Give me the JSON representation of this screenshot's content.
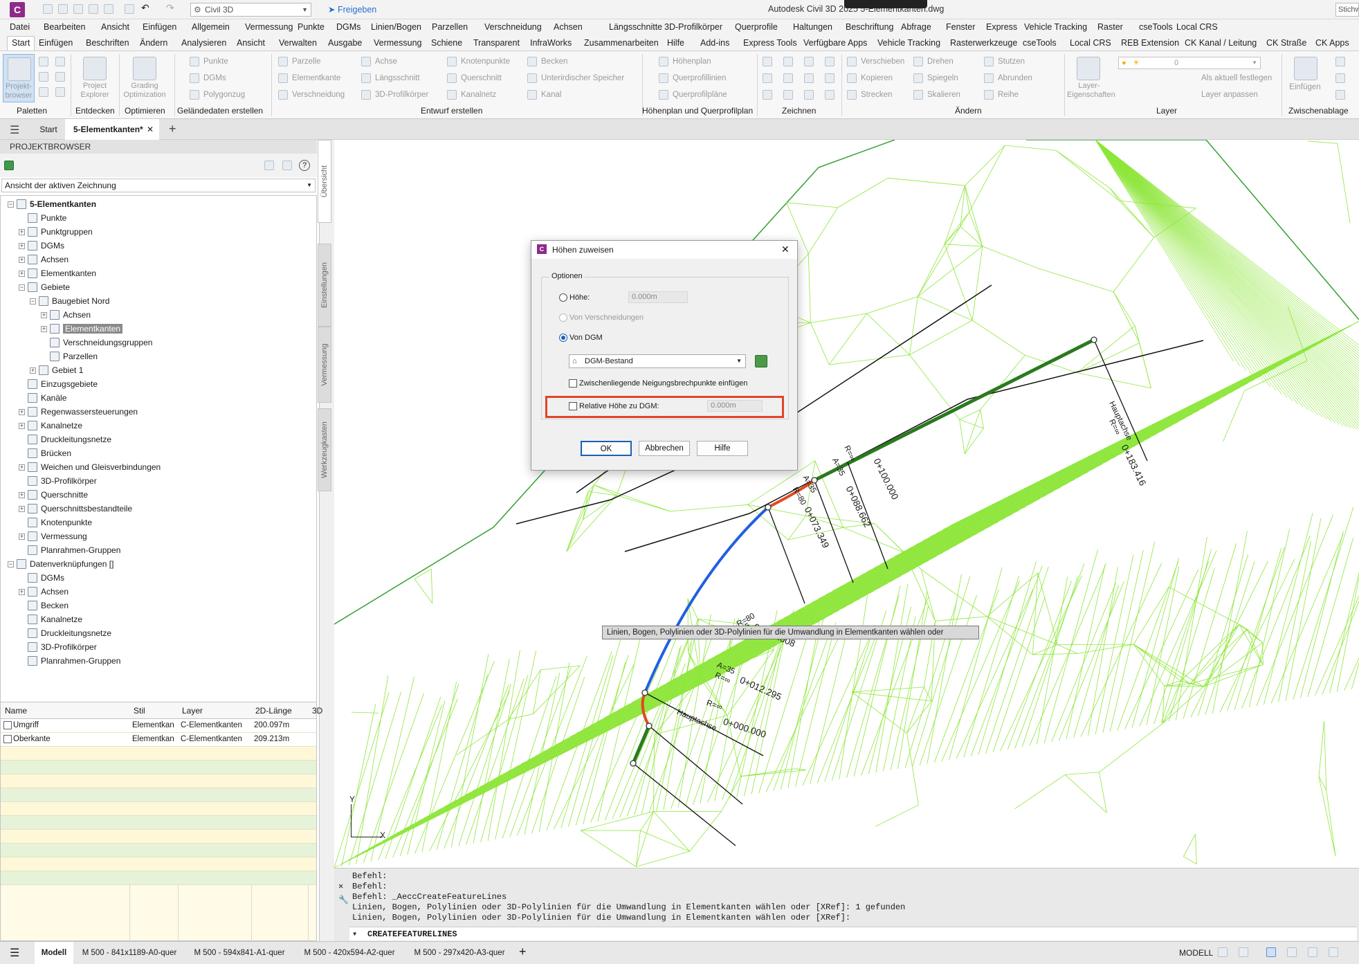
{
  "title": {
    "app_logo": "C",
    "workspace": "Civil 3D",
    "share": "Freigeben",
    "window_title": "Autodesk Civil 3D 2025   5-Elementkanten.dwg",
    "search": "Stichw"
  },
  "menu": [
    "Datei",
    "Bearbeiten",
    "Ansicht",
    "Einfügen",
    "Allgemein",
    "Vermessung",
    "Punkte",
    "DGMs",
    "Linien/Bogen",
    "Parzellen",
    "Verschneidung",
    "Achsen",
    "Längsschnitte",
    "3D-Profilkörper",
    "Querprofile",
    "Haltungen",
    "Beschriftung",
    "Abfrage",
    "Fenster",
    "Express",
    "Vehicle Tracking",
    "Raster",
    "cseTools",
    "Local CRS"
  ],
  "tabs": [
    "Start",
    "Einfügen",
    "Beschriften",
    "Ändern",
    "Analysieren",
    "Ansicht",
    "Verwalten",
    "Ausgabe",
    "Vermessung",
    "Schiene",
    "Transparent",
    "InfraWorks",
    "Zusammenarbeiten",
    "Hilfe",
    "Add-ins",
    "Express Tools",
    "Verfügbare Apps",
    "Vehicle Tracking",
    "Rasterwerkzeuge",
    "cseTools",
    "Local CRS",
    "REB Extension",
    "CK Kanal / Leitung",
    "CK Straße",
    "CK Apps"
  ],
  "ribbon": {
    "projektbrowser": "Projekt-browser",
    "projektexplorer": "Project Explorer",
    "grading": "Grading Optimization",
    "punkte": "Punkte",
    "dgms": "DGMs",
    "polygonzug": "Polygonzug",
    "parzelle": "Parzelle",
    "elementkante": "Elementkante",
    "verschneidung": "Verschneidung",
    "achse": "Achse",
    "laengsschnitt": "Längsschnitt",
    "profilkoerper": "3D-Profilkörper",
    "knotenpunkte": "Knotenpunkte",
    "querschnitt": "Querschnitt",
    "kanalnetz": "Kanalnetz",
    "becken": "Becken",
    "speicher": "Unterirdischer Speicher",
    "kanal": "Kanal",
    "hoehenplan": "Höhenplan",
    "querprofillinien": "Querprofillinien",
    "querprofilplaene": "Querprofilpläne",
    "verschieben": "Verschieben",
    "drehen": "Drehen",
    "stutzen": "Stutzen",
    "kopieren": "Kopieren",
    "spiegeln": "Spiegeln",
    "abrunden": "Abrunden",
    "strecken": "Strecken",
    "skalieren": "Skalieren",
    "reihe": "Reihe",
    "layer_eig": "Layer-Eigenschaften",
    "layer_value": "0",
    "als_aktuell": "Als aktuell festlegen",
    "layer_anpassen": "Layer anpassen",
    "einfuegen": "Einfügen",
    "panels": [
      "Paletten",
      "Entdecken",
      "Optimieren",
      "Geländedaten erstellen",
      "Entwurf erstellen",
      "Höhenplan und Querprofilplan",
      "Zeichnen",
      "Ändern",
      "Layer",
      "Zwischenablage"
    ]
  },
  "doctabs": {
    "start": "Start",
    "active": "5-Elementkanten*"
  },
  "browser": {
    "header": "PROJEKTBROWSER",
    "view_select": "Ansicht der aktiven Zeichnung",
    "side_tabs": [
      "Übersicht",
      "Einstellungen",
      "Vermessung",
      "Werkzeugkasten"
    ],
    "tree": [
      {
        "label": "5-Elementkanten",
        "level": 0,
        "exp": "-",
        "bold": true
      },
      {
        "label": "Punkte",
        "level": 1,
        "exp": ""
      },
      {
        "label": "Punktgruppen",
        "level": 1,
        "exp": "+"
      },
      {
        "label": "DGMs",
        "level": 1,
        "exp": "+"
      },
      {
        "label": "Achsen",
        "level": 1,
        "exp": "+"
      },
      {
        "label": "Elementkanten",
        "level": 1,
        "exp": "+"
      },
      {
        "label": "Gebiete",
        "level": 1,
        "exp": "-"
      },
      {
        "label": "Baugebiet Nord",
        "level": 2,
        "exp": "-"
      },
      {
        "label": "Achsen",
        "level": 3,
        "exp": "+"
      },
      {
        "label": "Elementkanten",
        "level": 3,
        "exp": "+",
        "sel": true
      },
      {
        "label": "Verschneidungsgruppen",
        "level": 3,
        "exp": ""
      },
      {
        "label": "Parzellen",
        "level": 3,
        "exp": ""
      },
      {
        "label": "Gebiet 1",
        "level": 2,
        "exp": "+"
      },
      {
        "label": "Einzugsgebiete",
        "level": 1,
        "exp": ""
      },
      {
        "label": "Kanäle",
        "level": 1,
        "exp": ""
      },
      {
        "label": "Regenwassersteuerungen",
        "level": 1,
        "exp": "+"
      },
      {
        "label": "Kanalnetze",
        "level": 1,
        "exp": "+"
      },
      {
        "label": "Druckleitungsnetze",
        "level": 1,
        "exp": ""
      },
      {
        "label": "Brücken",
        "level": 1,
        "exp": ""
      },
      {
        "label": "Weichen und Gleisverbindungen",
        "level": 1,
        "exp": "+"
      },
      {
        "label": "3D-Profilkörper",
        "level": 1,
        "exp": ""
      },
      {
        "label": "Querschnitte",
        "level": 1,
        "exp": "+"
      },
      {
        "label": "Querschnittsbestandteile",
        "level": 1,
        "exp": "+"
      },
      {
        "label": "Knotenpunkte",
        "level": 1,
        "exp": ""
      },
      {
        "label": "Vermessung",
        "level": 1,
        "exp": "+"
      },
      {
        "label": "Planrahmen-Gruppen",
        "level": 1,
        "exp": ""
      },
      {
        "label": "Datenverknüpfungen []",
        "level": 0,
        "exp": "-"
      },
      {
        "label": "DGMs",
        "level": 1,
        "exp": ""
      },
      {
        "label": "Achsen",
        "level": 1,
        "exp": "+"
      },
      {
        "label": "Becken",
        "level": 1,
        "exp": ""
      },
      {
        "label": "Kanalnetze",
        "level": 1,
        "exp": ""
      },
      {
        "label": "Druckleitungsnetze",
        "level": 1,
        "exp": ""
      },
      {
        "label": "3D-Profilkörper",
        "level": 1,
        "exp": ""
      },
      {
        "label": "Planrahmen-Gruppen",
        "level": 1,
        "exp": ""
      }
    ],
    "grid": {
      "columns": [
        "Name",
        "Stil",
        "Layer",
        "2D-Länge",
        "3D"
      ],
      "rows": [
        [
          "Umgriff",
          "Elementkan",
          "C-Elementkanten",
          "200.097m"
        ],
        [
          "Oberkante",
          "Elementkan",
          "C-Elementkanten",
          "209.213m"
        ]
      ]
    }
  },
  "dialog": {
    "title": "Höhen zuweisen",
    "group": "Optionen",
    "hoehe": "Höhe:",
    "hoehe_value": "0.000m",
    "von_verschneidungen": "Von Verschneidungen",
    "von_dgm": "Von DGM",
    "dgm_value": "DGM-Bestand",
    "zwischen": "Zwischenliegende Neigungsbrechpunkte einfügen",
    "relativ": "Relative Höhe zu DGM:",
    "relativ_value": "0.000m",
    "ok": "OK",
    "cancel": "Abbrechen",
    "help": "Hilfe",
    "highlight_color": "#e0452a"
  },
  "canvas": {
    "tooltip": "Linien, Bogen, Polylinien oder 3D-Polylinien für die Umwandlung in Elementkanten wählen oder",
    "labels": {
      "hauptachse_top": "Hauptachse",
      "r_inf_top": "R=∞",
      "st_183": "0+183.416",
      "st_100": "0+100.000",
      "st_088": "0+088.662",
      "r_inf_088": "R=∞",
      "a35_088": "A=35",
      "st_073": "0+073.349",
      "a35_073": "A=35",
      "r80_073": "R=80",
      "st_027": "0+027.608",
      "r80_027": "R=80",
      "a35_027": "A=35",
      "st_012": "0+012.295",
      "a35_012": "A=35",
      "r_inf_012": "R=∞",
      "st_000": "0+000.000",
      "r_inf_000": "R=∞",
      "hauptachse_bot": "Hauptachse",
      "axis_y": "Y",
      "axis_x": "X"
    },
    "mesh_color": "#8ee63a"
  },
  "cmd": {
    "lines": [
      "Befehl:",
      "Befehl:",
      "Befehl: _AeccCreateFeatureLines",
      "Linien, Bogen, Polylinien oder 3D-Polylinien für die Umwandlung in Elementkanten wählen oder [XRef]: 1 gefunden",
      "Linien, Bogen, Polylinien oder 3D-Polylinien für die Umwandlung in Elementkanten wählen oder [XRef]:"
    ],
    "input": "CREATEFEATURELINES"
  },
  "status": {
    "tabs": [
      "Modell",
      "M 500 - 841x1189-A0-quer",
      "M 500 - 594x841-A1-quer",
      "M 500 - 420x594-A2-quer",
      "M 500 - 297x420-A3-quer"
    ],
    "model": "MODELL"
  }
}
